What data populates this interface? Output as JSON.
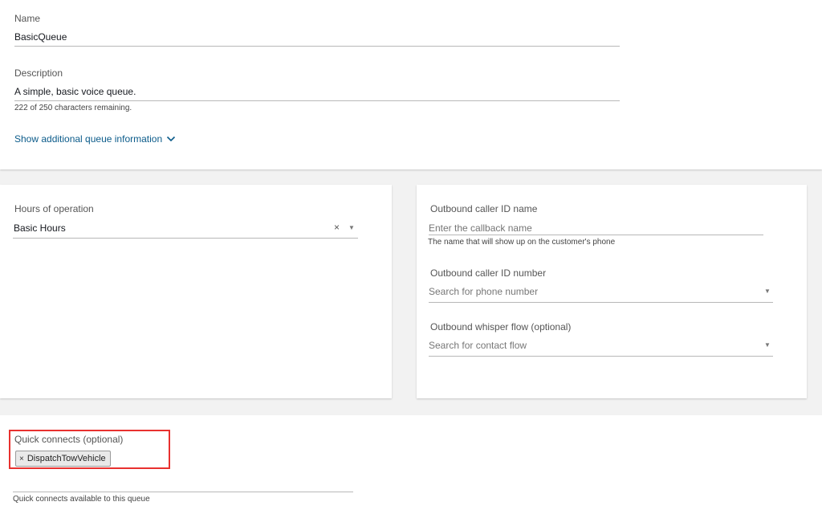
{
  "queue": {
    "name_label": "Name",
    "name_value": "BasicQueue",
    "description_label": "Description",
    "description_value": "A simple, basic voice queue.",
    "char_count": "222 of 250 characters remaining.",
    "more_info_link": "Show additional queue information",
    "more_info_icon": "chevron-down-icon"
  },
  "hours": {
    "label": "Hours of operation",
    "value": "Basic Hours",
    "clear_glyph": "×",
    "caret_glyph": "▼"
  },
  "outbound": {
    "caller_name_label": "Outbound caller ID name",
    "caller_name_placeholder": "Enter the callback name",
    "caller_name_hint": "The name that will show up on the customer's phone",
    "caller_number_label": "Outbound caller ID number",
    "caller_number_placeholder": "Search for phone number",
    "whisper_label": "Outbound whisper flow (optional)",
    "whisper_placeholder": "Search for contact flow",
    "caret_glyph": "▼"
  },
  "quick_connects": {
    "label": "Quick connects (optional)",
    "chips": [
      {
        "label": "DispatchTowVehicle",
        "remove_glyph": "×"
      }
    ],
    "hint": "Quick connects available to this queue",
    "highlight_color": "#e8312f"
  }
}
